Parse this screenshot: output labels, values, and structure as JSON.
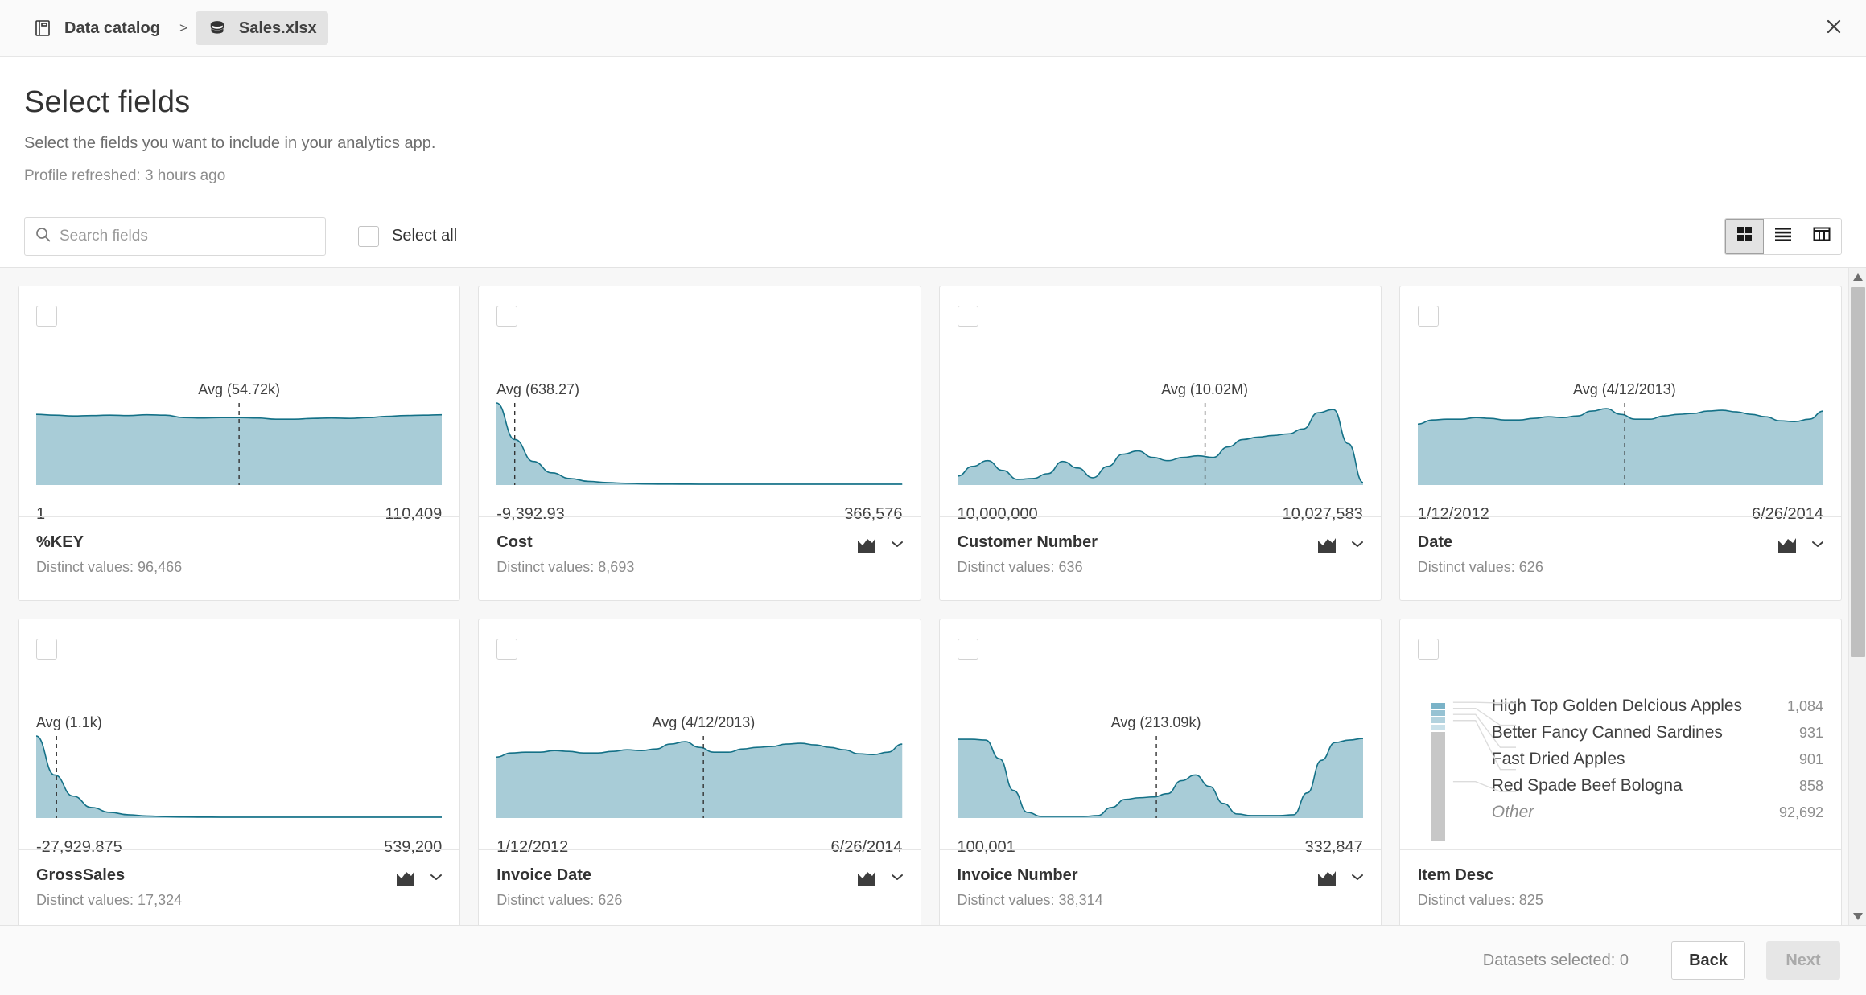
{
  "breadcrumb": {
    "catalog_label": "Data catalog",
    "separator": ">",
    "file_label": "Sales.xlsx"
  },
  "header": {
    "title": "Select fields",
    "subtitle": "Select the fields you want to include in your analytics app.",
    "profile_refreshed": "Profile refreshed: 3 hours ago"
  },
  "toolbar": {
    "search_placeholder": "Search fields",
    "search_value": "",
    "select_all_label": "Select all",
    "views": [
      {
        "name": "grid-view",
        "active": true
      },
      {
        "name": "list-view",
        "active": false
      },
      {
        "name": "table-view",
        "active": false
      }
    ]
  },
  "colors": {
    "area_fill": "#a8ccd7",
    "area_line": "#147187",
    "bar_other": "#c7c7c7",
    "accent_dark": "#404040"
  },
  "cards": [
    {
      "name": "%KEY",
      "distinct_label": "Distinct values: 96,466",
      "has_tools": false,
      "chart_data": {
        "type": "area",
        "title": "%KEY",
        "avg_label": "Avg (54.72k)",
        "avg_pos_pct": 50,
        "min_label": "1",
        "max_label": "110,409",
        "values": [
          0.86,
          0.85,
          0.84,
          0.845,
          0.85,
          0.845,
          0.855,
          0.85,
          0.82,
          0.815,
          0.82,
          0.82,
          0.815,
          0.8,
          0.8,
          0.81,
          0.815,
          0.81,
          0.82,
          0.835,
          0.845,
          0.85,
          0.855
        ]
      }
    },
    {
      "name": "Cost",
      "distinct_label": "Distinct values: 8,693",
      "has_tools": true,
      "chart_data": {
        "type": "area",
        "title": "Cost",
        "avg_label": "Avg (638.27)",
        "avg_pos_pct": 4.5,
        "avg_align": "left",
        "min_label": "-9,392.93",
        "max_label": "366,576",
        "values": [
          1.0,
          0.55,
          0.28,
          0.14,
          0.07,
          0.035,
          0.02,
          0.012,
          0.006,
          0.003,
          0.002,
          0.001,
          0.001,
          0.001,
          0.001,
          0.001,
          0.001,
          0.001,
          0.001,
          0.001,
          0.001,
          0.001,
          0.001
        ]
      }
    },
    {
      "name": "Customer Number",
      "distinct_label": "Distinct values: 636",
      "has_tools": true,
      "chart_data": {
        "type": "area",
        "title": "Customer Number",
        "avg_label": "Avg (10.02M)",
        "avg_pos_pct": 61,
        "min_label": "10,000,000",
        "max_label": "10,027,583",
        "values": [
          0.1,
          0.22,
          0.29,
          0.17,
          0.06,
          0.07,
          0.13,
          0.28,
          0.2,
          0.08,
          0.22,
          0.37,
          0.41,
          0.33,
          0.29,
          0.33,
          0.35,
          0.33,
          0.46,
          0.55,
          0.58,
          0.6,
          0.62,
          0.68,
          0.88,
          0.92,
          0.5,
          0.02
        ]
      }
    },
    {
      "name": "Date",
      "distinct_label": "Distinct values: 626",
      "has_tools": true,
      "chart_data": {
        "type": "area",
        "title": "Date",
        "avg_label": "Avg (4/12/2013)",
        "avg_pos_pct": 51,
        "min_label": "1/12/2012",
        "max_label": "6/26/2014",
        "values": [
          0.74,
          0.79,
          0.8,
          0.8,
          0.82,
          0.81,
          0.79,
          0.79,
          0.81,
          0.83,
          0.82,
          0.84,
          0.9,
          0.93,
          0.86,
          0.8,
          0.8,
          0.84,
          0.86,
          0.87,
          0.9,
          0.91,
          0.89,
          0.86,
          0.83,
          0.78,
          0.77,
          0.8,
          0.9
        ]
      }
    },
    {
      "name": "GrossSales",
      "distinct_label": "Distinct values: 17,324",
      "has_tools": true,
      "chart_data": {
        "type": "area",
        "title": "GrossSales",
        "avg_label": "Avg (1.1k)",
        "avg_pos_pct": 5,
        "avg_align": "left",
        "min_label": "-27,929.875",
        "max_label": "539,200",
        "values": [
          1.0,
          0.52,
          0.26,
          0.12,
          0.06,
          0.03,
          0.015,
          0.008,
          0.004,
          0.002,
          0.001,
          0.001,
          0.001,
          0.001,
          0.001,
          0.001,
          0.001,
          0.001,
          0.001,
          0.001,
          0.001,
          0.001,
          0.001
        ]
      }
    },
    {
      "name": "Invoice Date",
      "distinct_label": "Distinct values: 626",
      "has_tools": true,
      "chart_data": {
        "type": "area",
        "title": "Invoice Date",
        "avg_label": "Avg (4/12/2013)",
        "avg_pos_pct": 51,
        "min_label": "1/12/2012",
        "max_label": "6/26/2014",
        "values": [
          0.74,
          0.79,
          0.8,
          0.8,
          0.82,
          0.81,
          0.79,
          0.79,
          0.81,
          0.83,
          0.82,
          0.84,
          0.9,
          0.93,
          0.86,
          0.8,
          0.8,
          0.84,
          0.86,
          0.87,
          0.9,
          0.91,
          0.89,
          0.86,
          0.83,
          0.78,
          0.77,
          0.8,
          0.9
        ]
      }
    },
    {
      "name": "Invoice Number",
      "distinct_label": "Distinct values: 38,314",
      "has_tools": true,
      "chart_data": {
        "type": "area",
        "title": "Invoice Number",
        "avg_label": "Avg (213.09k)",
        "avg_pos_pct": 49,
        "min_label": "100,001",
        "max_label": "332,847",
        "values": [
          0.96,
          0.96,
          0.95,
          0.72,
          0.33,
          0.06,
          0.01,
          0.01,
          0.01,
          0.01,
          0.02,
          0.12,
          0.22,
          0.24,
          0.25,
          0.29,
          0.45,
          0.52,
          0.38,
          0.17,
          0.04,
          0.02,
          0.02,
          0.02,
          0.03,
          0.3,
          0.7,
          0.92,
          0.95,
          0.97
        ]
      }
    },
    {
      "name": "Item Desc",
      "distinct_label": "Distinct values: 825",
      "has_tools": false,
      "chart_data": {
        "type": "bar",
        "title": "Item Desc",
        "categories": [
          "High Top Golden Delcious Apples",
          "Better Fancy Canned Sardines",
          "Fast Dried Apples",
          "Red Spade Beef Bologna",
          "Other"
        ],
        "values": [
          1084,
          931,
          901,
          858,
          92692
        ],
        "value_labels": [
          "1,084",
          "931",
          "901",
          "858",
          "92,692"
        ]
      }
    }
  ],
  "footer": {
    "datasets_selected": "Datasets selected: 0",
    "back_label": "Back",
    "next_label": "Next"
  }
}
